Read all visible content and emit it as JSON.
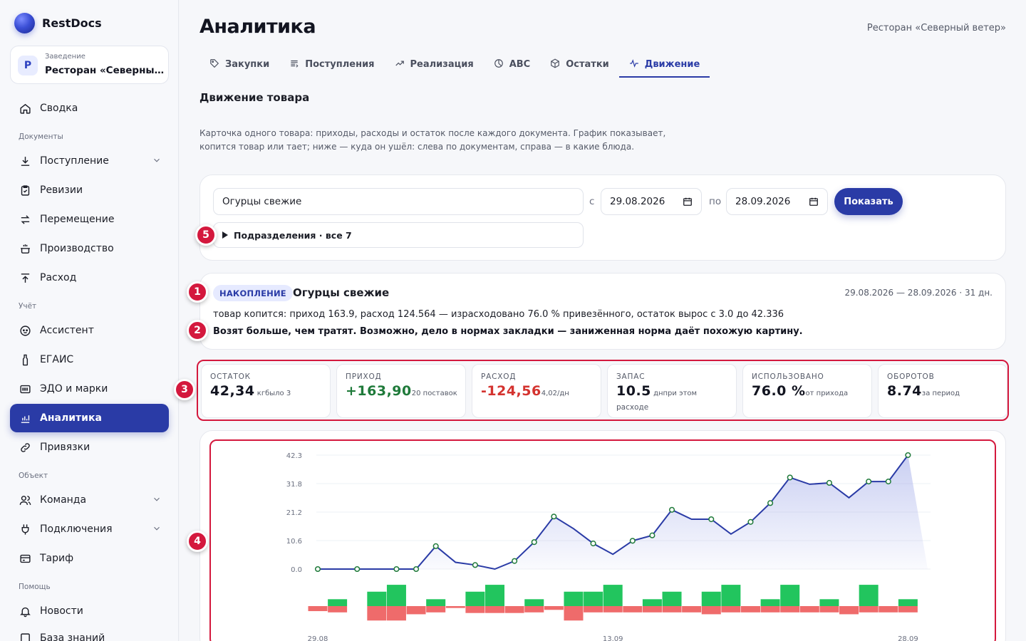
{
  "app": {
    "name": "RestDocs"
  },
  "venue": {
    "caption": "Заведение",
    "initial": "Р",
    "name": "Ресторан «Северный ветер»"
  },
  "nav": {
    "summary": "Сводка",
    "section_docs": "Документы",
    "receipt": "Поступление",
    "audits": "Ревизии",
    "transfer": "Перемещение",
    "production": "Производство",
    "expense": "Расход",
    "section_accounting": "Учёт",
    "assistant": "Ассистент",
    "egais": "ЕГАИС",
    "edo": "ЭДО и марки",
    "analytics": "Аналитика",
    "bindings": "Привязки",
    "section_object": "Объект",
    "team": "Команда",
    "connections": "Подключения",
    "tariff": "Тариф",
    "section_help": "Помощь",
    "news": "Новости",
    "kb": "База знаний"
  },
  "header": {
    "title": "Аналитика",
    "venue": "Ресторан «Северный ветер»"
  },
  "tabs": [
    "Закупки",
    "Поступления",
    "Реализация",
    "ABC",
    "Остатки",
    "Движение"
  ],
  "section": {
    "title": "Движение товара",
    "desc": "Карточка одного товара: приходы, расходы и остаток после каждого документа. График показывает, копится товар или тает; ниже — куда он ушёл: слева по документам, справа — в какие блюда."
  },
  "filter": {
    "product": "Огурцы свежие",
    "from_label": "с",
    "from": "29.08.2026",
    "to_label": "по",
    "to": "28.09.2026",
    "button": "Показать",
    "subdivisions": "Подразделения · все 7"
  },
  "markers": [
    "1",
    "2",
    "3",
    "4",
    "5"
  ],
  "summary": {
    "badge": "НАКОПЛЕНИЕ",
    "title": "Огурцы свежие",
    "period": "29.08.2026 — 28.09.2026 · 31 дн.",
    "line1": "товар копится: приход 163.9, расход 124.564 — израсходовано 76.0 % привезённого, остаток вырос с 3.0 до 42.336",
    "line2": "Возят больше, чем тратят. Возможно, дело в нормах закладки — заниженная норма даёт похожую картину."
  },
  "kpis": [
    {
      "label": "ОСТАТОК",
      "value": "42,34",
      "sub": " кгбыло 3",
      "color": "#121420"
    },
    {
      "label": "ПРИХОД",
      "value": "+163,90",
      "sub": "20 поставок",
      "color": "#1f7a3a"
    },
    {
      "label": "РАСХОД",
      "value": "-124,56",
      "sub": "4,02/дн",
      "color": "#d4332f"
    },
    {
      "label": "ЗАПАС",
      "value": "10.5",
      "sub": " днпри этом",
      "sub2": "расходе",
      "color": "#121420"
    },
    {
      "label": "ИСПОЛЬЗОВАНО",
      "value": "76.0 %",
      "sub": "от прихода",
      "color": "#121420"
    },
    {
      "label": "ОБОРОТОВ",
      "value": "8.74",
      "sub": "за период",
      "color": "#121420"
    }
  ],
  "chart_data": {
    "type": "line",
    "y_ticks": [
      "42.3",
      "31.8",
      "21.2",
      "10.6",
      "0.0"
    ],
    "ylim": [
      0,
      42.3
    ],
    "x_tick_labels": [
      "29.08",
      "13.09",
      "28.09"
    ],
    "x": [
      "29.08",
      "30.08",
      "31.08",
      "01.09",
      "02.09",
      "03.09",
      "04.09",
      "05.09",
      "06.09",
      "07.09",
      "08.09",
      "09.09",
      "10.09",
      "11.09",
      "12.09",
      "13.09",
      "14.09",
      "15.09",
      "16.09",
      "17.09",
      "18.09",
      "19.09",
      "20.09",
      "21.09",
      "22.09",
      "23.09",
      "24.09",
      "25.09",
      "26.09",
      "27.09",
      "28.09",
      "29.09"
    ],
    "series": [
      {
        "values": [
          0,
          0,
          0,
          0,
          0,
          0,
          8.5,
          2.5,
          1.5,
          0,
          3,
          10,
          19.5,
          15,
          9.5,
          5.5,
          10.5,
          12.5,
          22,
          18.5,
          18.5,
          13,
          17.5,
          24.5,
          34,
          31.5,
          32,
          26.5,
          32.5,
          32.5,
          42.3,
          0
        ]
      }
    ],
    "markers_at": [
      0,
      2,
      4,
      5,
      6,
      8,
      10,
      11,
      12,
      14,
      16,
      17,
      18,
      20,
      22,
      23,
      24,
      26,
      28,
      29,
      30
    ],
    "inflow": [
      0,
      2.2,
      0,
      4.6,
      6.8,
      0,
      2.2,
      0,
      4.6,
      6.8,
      0,
      2.2,
      0,
      4.6,
      4.6,
      6.8,
      0,
      2.2,
      4.6,
      0,
      4.6,
      6.8,
      0,
      2.2,
      6.8,
      0,
      2.2,
      0,
      6.8,
      0,
      2.2
    ],
    "outflow": [
      1.6,
      2.0,
      0,
      4.6,
      4.6,
      2.6,
      2.0,
      0.6,
      2.2,
      2.2,
      2.2,
      2.0,
      1.2,
      4.6,
      2.0,
      2.0,
      2.0,
      2.0,
      2.0,
      2.0,
      2.6,
      2.0,
      2.0,
      2.0,
      2.0,
      2.0,
      2.0,
      2.6,
      2.0,
      2.0,
      2.0
    ],
    "colors": {
      "line": "#2a3ba6",
      "area": "#9ea8e8",
      "marker": "#1f7a3a",
      "inflow": "#22c55e",
      "outflow": "#ef6b6b"
    }
  }
}
